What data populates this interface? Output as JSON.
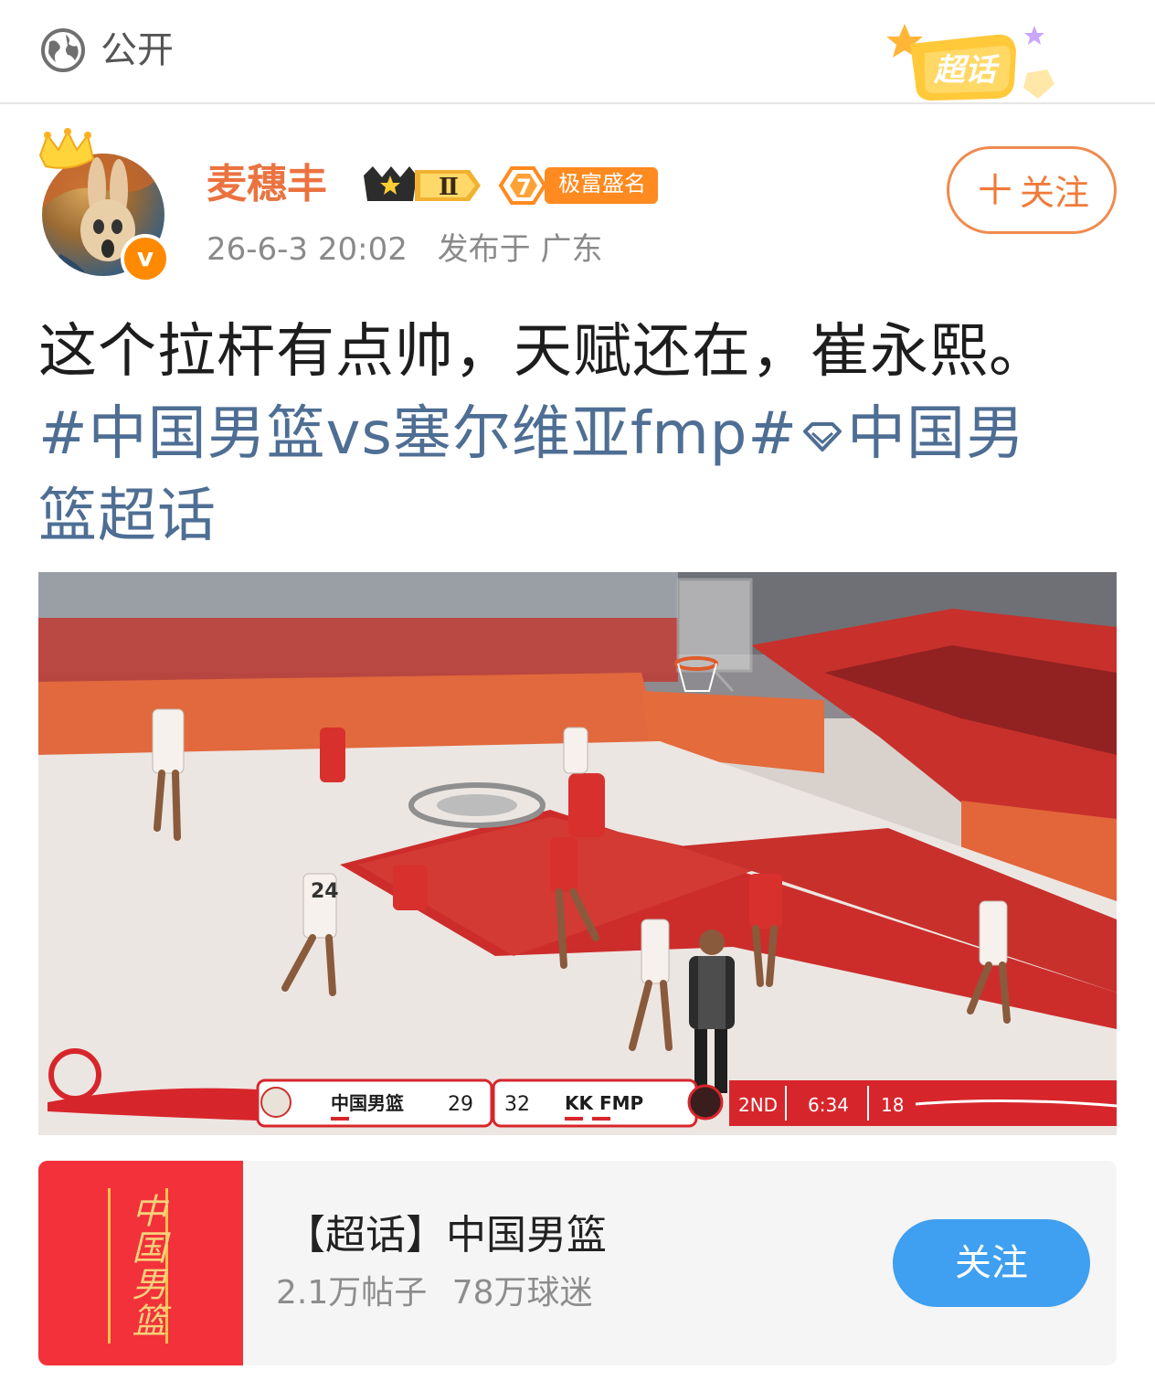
{
  "header": {
    "visibility_icon": "globe-icon",
    "visibility_label": "公开",
    "supertopic_badge": "超话"
  },
  "author": {
    "name": "麦穗丰",
    "vip_level": "Ⅱ",
    "fame_level": "7",
    "fame_label": "极富盛名",
    "verified_icon": "v",
    "time": "26-6-3 20:02",
    "location": "发布于 广东",
    "follow_label": "关注"
  },
  "post": {
    "text": "这个拉杆有点帅，天赋还在，崔永熙。",
    "topic_tag": "#中国男篮vs塞尔维亚fmp#",
    "supertopic_link_part1": "中国男",
    "supertopic_link_part2": "篮超话"
  },
  "video": {
    "scoreboard": {
      "home_team": "中国男篮",
      "home_score": "29",
      "away_score": "32",
      "away_team": "KK  FMP",
      "period": "2ND",
      "clock": "6:34",
      "shot_clock": "18"
    },
    "jersey_number": "24"
  },
  "topic_card": {
    "thumb_text": "中国男篮",
    "title": "【超话】中国男篮",
    "posts": "2.1万帖子",
    "fans": "78万球迷",
    "follow_label": "关注"
  },
  "colors": {
    "username": "#eb7340",
    "topic_link": "#4e6e94",
    "follow_outline": "#f08a4e",
    "card_follow_bg": "#3f9ff0",
    "card_thumb_bg": "#f2313b"
  }
}
